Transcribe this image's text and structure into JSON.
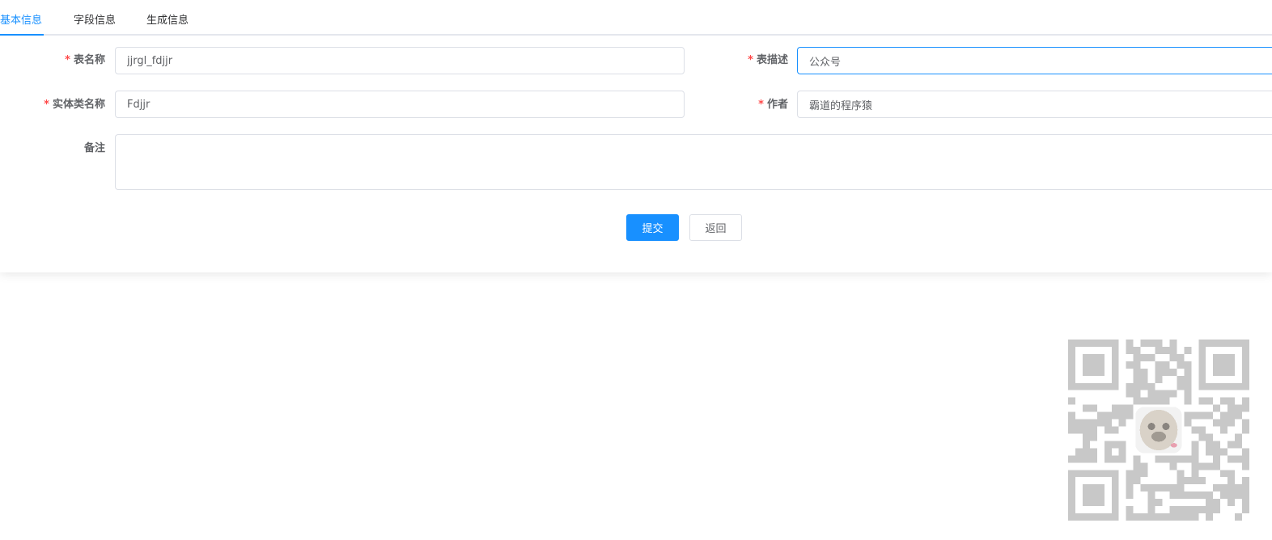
{
  "tabs": [
    {
      "label": "基本信息",
      "active": true
    },
    {
      "label": "字段信息",
      "active": false
    },
    {
      "label": "生成信息",
      "active": false
    }
  ],
  "form": {
    "table_name": {
      "label": "表名称",
      "required": true,
      "value": "jjrgl_fdjjr"
    },
    "table_desc": {
      "label": "表描述",
      "required": true,
      "value": "公众号"
    },
    "class_name": {
      "label": "实体类名称",
      "required": true,
      "value": "Fdjjr"
    },
    "author": {
      "label": "作者",
      "required": true,
      "value": "霸道的程序猿"
    },
    "remark": {
      "label": "备注",
      "required": false,
      "value": ""
    }
  },
  "buttons": {
    "submit": "提交",
    "back": "返回"
  },
  "colors": {
    "accent": "#1890ff",
    "required": "#ff4949"
  },
  "qr_code": {
    "icon": "qr-code-with-pug-avatar"
  }
}
